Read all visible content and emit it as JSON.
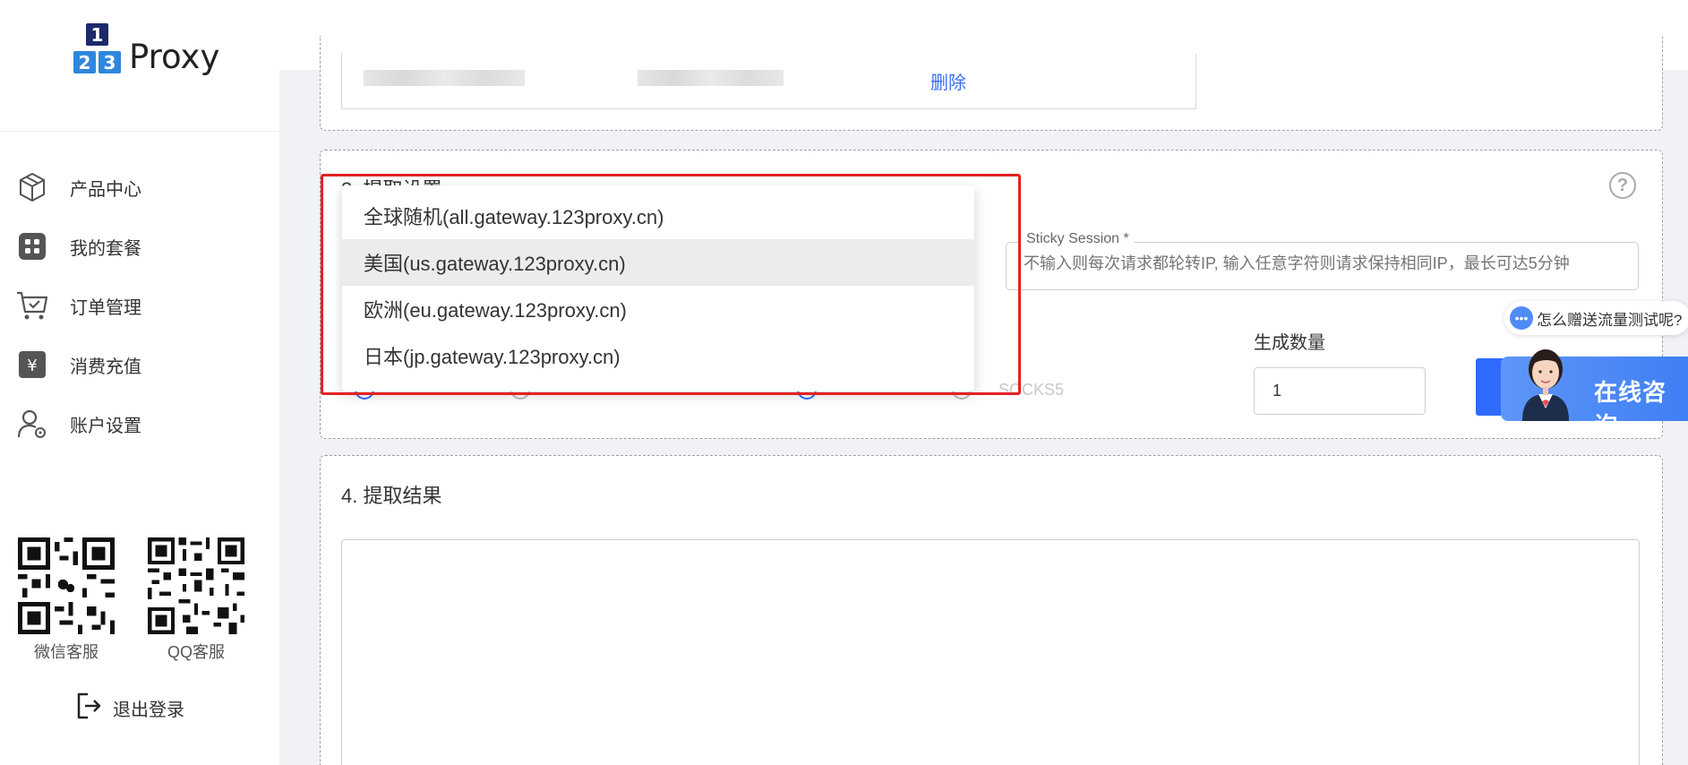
{
  "logo": {
    "digits": [
      "1",
      "2",
      "3"
    ],
    "word": "Proxy"
  },
  "sidebar": {
    "items": [
      {
        "label": "产品中心",
        "icon": "cube-icon"
      },
      {
        "label": "我的套餐",
        "icon": "grid-icon"
      },
      {
        "label": "订单管理",
        "icon": "cart-icon"
      },
      {
        "label": "消费充值",
        "icon": "yuan-icon"
      },
      {
        "label": "账户设置",
        "icon": "user-gear-icon"
      }
    ],
    "qr": [
      {
        "label": "微信客服",
        "icon": "wechat-qr-icon"
      },
      {
        "label": "QQ客服",
        "icon": "qq-qr-icon"
      }
    ],
    "logout_label": "退出登录"
  },
  "whitelist": {
    "delete_label": "删除"
  },
  "extract_settings": {
    "title": "3. 提取设置",
    "sticky_label": "Sticky Session *",
    "sticky_placeholder": "不输入则每次请求都轮转IP, 输入任意字符则请求保持相同IP，最长可达5分钟",
    "gen_count_label": "生成数量",
    "gen_count_value": "1",
    "protocol_socks": "SOCKS5"
  },
  "dropdown": {
    "options": [
      "全球随机(all.gateway.123proxy.cn)",
      "美国(us.gateway.123proxy.cn)",
      "欧洲(eu.gateway.123proxy.cn)",
      "日本(jp.gateway.123proxy.cn)"
    ],
    "highlighted_index": 1
  },
  "result": {
    "title": "4. 提取结果"
  },
  "chat": {
    "bubble_text": "怎么赠送流量测试呢?",
    "consult_label": "在线咨询"
  },
  "colors": {
    "accent": "#2f6bff",
    "highlight": "#e42323",
    "logo_dark": "#1b2a6b",
    "logo_blue": "#2e86de"
  }
}
